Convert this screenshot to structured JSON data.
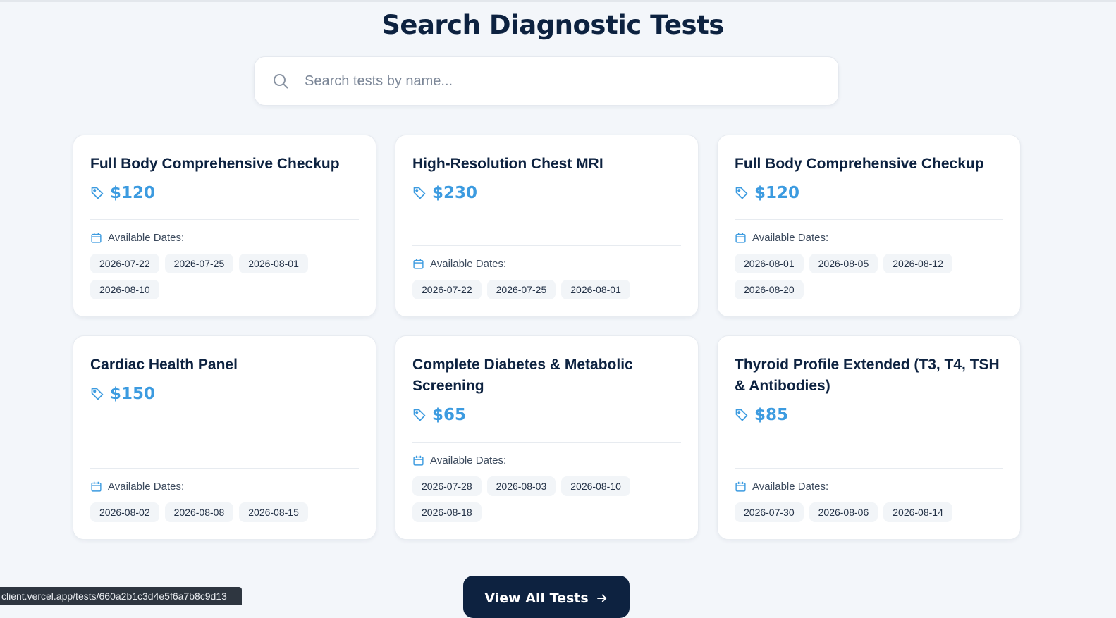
{
  "page": {
    "title": "Search Diagnostic Tests"
  },
  "search": {
    "placeholder": "Search tests by name...",
    "value": "",
    "icon": "search-icon"
  },
  "labels": {
    "available_dates": "Available Dates:"
  },
  "colors": {
    "accent": "#3c9be0",
    "navy": "#0d2240",
    "background": "#f3f6fa"
  },
  "tests": [
    {
      "name": "Full Body Comprehensive Checkup",
      "price": "$120",
      "dates": [
        "2026-07-22",
        "2026-07-25",
        "2026-08-01",
        "2026-08-10"
      ]
    },
    {
      "name": "High-Resolution Chest MRI",
      "price": "$230",
      "dates": [
        "2026-07-22",
        "2026-07-25",
        "2026-08-01"
      ]
    },
    {
      "name": "Full Body Comprehensive Checkup",
      "price": "$120",
      "dates": [
        "2026-08-01",
        "2026-08-05",
        "2026-08-12",
        "2026-08-20"
      ]
    },
    {
      "name": "Cardiac Health Panel",
      "price": "$150",
      "dates": [
        "2026-08-02",
        "2026-08-08",
        "2026-08-15"
      ]
    },
    {
      "name": "Complete Diabetes & Metabolic Screening",
      "price": "$65",
      "dates": [
        "2026-07-28",
        "2026-08-03",
        "2026-08-10",
        "2026-08-18"
      ]
    },
    {
      "name": "Thyroid Profile Extended (T3, T4, TSH & Antibodies)",
      "price": "$85",
      "dates": [
        "2026-07-30",
        "2026-08-06",
        "2026-08-14"
      ]
    }
  ],
  "view_all_button": {
    "label": "View All Tests",
    "icon": "arrow-right-icon"
  },
  "status_bar": {
    "url": "client.vercel.app/tests/660a2b1c3d4e5f6a7b8c9d13"
  }
}
